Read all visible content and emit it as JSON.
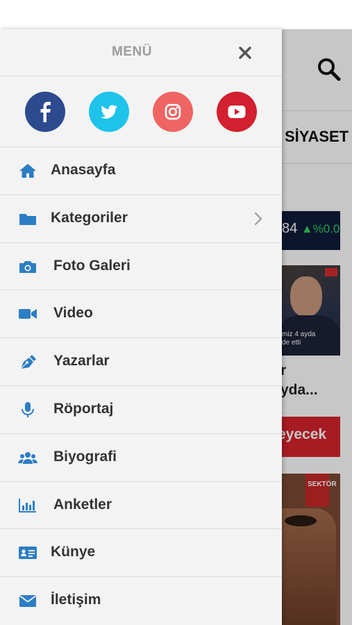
{
  "background": {
    "category_label": "SİYASET",
    "ticker": {
      "value": "84",
      "change": "%0.0"
    },
    "image_caption": "miz 4 ayda\nde etti",
    "card_text": "r\nyda...",
    "red_button_label": "eyecek",
    "logo_text": "SEKTÖR"
  },
  "drawer": {
    "title": "MENÜ",
    "social": [
      {
        "name": "facebook",
        "color": "#2d4a8f"
      },
      {
        "name": "twitter",
        "color": "#1ec3ea"
      },
      {
        "name": "instagram",
        "color": "#f06464"
      },
      {
        "name": "youtube",
        "color": "#d2202f"
      }
    ],
    "items": [
      {
        "label": "Anasayfa",
        "icon": "home-icon"
      },
      {
        "label": "Kategoriler",
        "icon": "folder-icon",
        "has_submenu": true
      },
      {
        "label": "Foto Galeri",
        "icon": "camera-icon"
      },
      {
        "label": "Video",
        "icon": "video-icon"
      },
      {
        "label": "Yazarlar",
        "icon": "pen-icon"
      },
      {
        "label": "Röportaj",
        "icon": "microphone-icon"
      },
      {
        "label": "Biyografi",
        "icon": "users-icon"
      },
      {
        "label": "Anketler",
        "icon": "poll-chart-icon"
      },
      {
        "label": "Künye",
        "icon": "id-card-icon"
      },
      {
        "label": "İletişim",
        "icon": "envelope-icon"
      }
    ]
  },
  "colors": {
    "icon_blue": "#2c7ec4",
    "drawer_bg": "#f3f3f3",
    "text_dark": "#333333",
    "title_gray": "#9b9b9b"
  }
}
